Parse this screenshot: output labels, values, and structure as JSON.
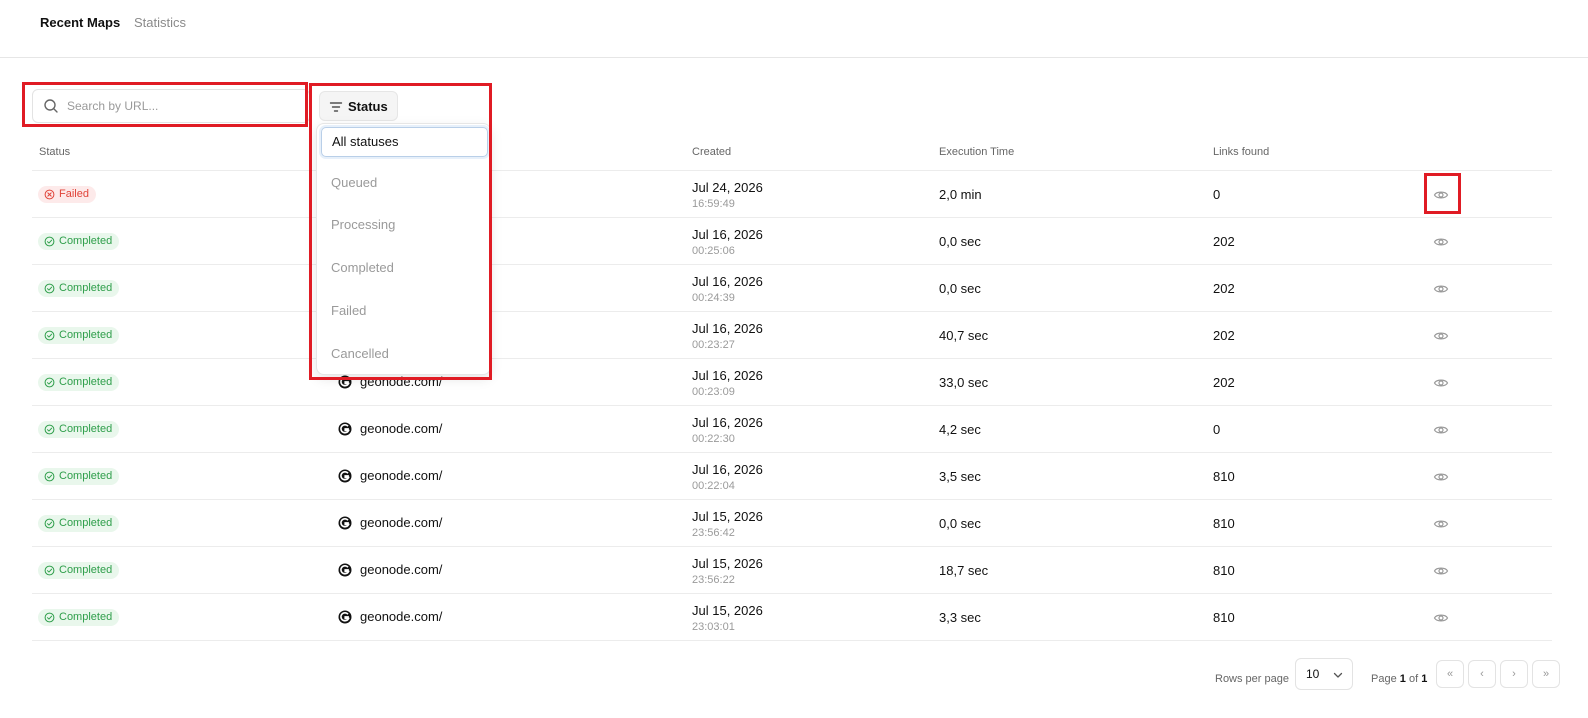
{
  "tabs": [
    {
      "label": "Recent Maps",
      "active": true
    },
    {
      "label": "Statistics",
      "active": false
    }
  ],
  "search": {
    "placeholder": "Search by URL...",
    "value": ""
  },
  "status_filter": {
    "label": "Status",
    "options": [
      "All statuses",
      "Queued",
      "Processing",
      "Completed",
      "Failed",
      "Cancelled"
    ],
    "selected": "All statuses"
  },
  "table": {
    "headers": {
      "status": "Status",
      "created": "Created",
      "execution_time": "Execution Time",
      "links_found": "Links found"
    },
    "rows": [
      {
        "status": "Failed",
        "url": "",
        "date": "Jul 24, 2026",
        "time": "16:59:49",
        "exec": "2,0 min",
        "links": "0"
      },
      {
        "status": "Completed",
        "url": "",
        "date": "Jul 16, 2026",
        "time": "00:25:06",
        "exec": "0,0 sec",
        "links": "202"
      },
      {
        "status": "Completed",
        "url": "",
        "date": "Jul 16, 2026",
        "time": "00:24:39",
        "exec": "0,0 sec",
        "links": "202"
      },
      {
        "status": "Completed",
        "url": "",
        "date": "Jul 16, 2026",
        "time": "00:23:27",
        "exec": "40,7 sec",
        "links": "202"
      },
      {
        "status": "Completed",
        "url": "geonode.com/",
        "date": "Jul 16, 2026",
        "time": "00:23:09",
        "exec": "33,0 sec",
        "links": "202"
      },
      {
        "status": "Completed",
        "url": "geonode.com/",
        "date": "Jul 16, 2026",
        "time": "00:22:30",
        "exec": "4,2 sec",
        "links": "0"
      },
      {
        "status": "Completed",
        "url": "geonode.com/",
        "date": "Jul 16, 2026",
        "time": "00:22:04",
        "exec": "3,5 sec",
        "links": "810"
      },
      {
        "status": "Completed",
        "url": "geonode.com/",
        "date": "Jul 15, 2026",
        "time": "23:56:42",
        "exec": "0,0 sec",
        "links": "810"
      },
      {
        "status": "Completed",
        "url": "geonode.com/",
        "date": "Jul 15, 2026",
        "time": "23:56:22",
        "exec": "18,7 sec",
        "links": "810"
      },
      {
        "status": "Completed",
        "url": "geonode.com/",
        "date": "Jul 15, 2026",
        "time": "23:03:01",
        "exec": "3,3 sec",
        "links": "810"
      }
    ]
  },
  "pagination": {
    "rows_per_page_label": "Rows per page",
    "rows_per_page": "10",
    "page_prefix": "Page",
    "page_current": "1",
    "page_of": "of",
    "page_total": "1",
    "buttons": [
      "«",
      "‹",
      "›",
      "»"
    ]
  },
  "colors": {
    "highlight": "#e01b24",
    "completed_bg": "#e9f7ec",
    "completed_text": "#2e9e4a",
    "failed_bg": "#fdeaea",
    "failed_text": "#e0443a"
  },
  "icons": {
    "search": "search-icon",
    "filter": "filter-icon",
    "completed": "check-circle-icon",
    "failed": "x-circle-icon",
    "view": "eye-icon",
    "site_logo": "geonode-logo-icon",
    "select": "chevron-down-icon"
  }
}
